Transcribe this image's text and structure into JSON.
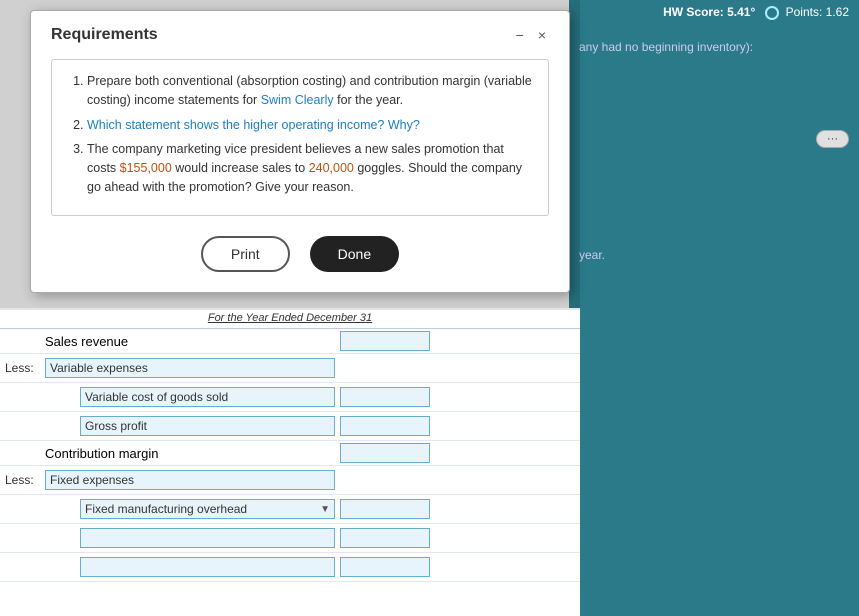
{
  "header": {
    "hw_score_label": "HW Score:",
    "hw_score_value": "5.41°",
    "points_label": "Points:",
    "points_value": "1.62"
  },
  "right_panel": {
    "intro_text": "any had no beginning inventory):",
    "year_text": "year.",
    "expand_btn": "›"
  },
  "modal": {
    "title": "Requirements",
    "minimize": "−",
    "close": "×",
    "requirements": [
      {
        "number": 1,
        "text_parts": [
          {
            "text": "Prepare both conventional (absorption costing) and contribution margin (variable costing) income statements for ",
            "style": "normal"
          },
          {
            "text": "Swim Clearly",
            "style": "highlight"
          },
          {
            "text": " for the year.",
            "style": "normal"
          }
        ]
      },
      {
        "number": 2,
        "text_parts": [
          {
            "text": "Which statement shows the higher operating income? ",
            "style": "highlight"
          },
          {
            "text": "Why?",
            "style": "highlight"
          }
        ]
      },
      {
        "number": 3,
        "text_parts": [
          {
            "text": "The company marketing vice president believes a new sales promotion that costs ",
            "style": "normal"
          },
          {
            "text": "$155,000",
            "style": "orange"
          },
          {
            "text": " would increase sales to ",
            "style": "normal"
          },
          {
            "text": "240,000",
            "style": "orange"
          },
          {
            "text": " goggles. Should the company go ahead with the promotion? Give your reason.",
            "style": "normal"
          }
        ]
      }
    ],
    "print_btn": "Print",
    "done_btn": "Done"
  },
  "table": {
    "header_text": "For the Year Ended December 31",
    "rows": [
      {
        "type": "main",
        "label": "Sales revenue",
        "has_input": true
      },
      {
        "type": "less_header",
        "less": "Less:",
        "sublabel": "Variable expenses",
        "has_input": false
      },
      {
        "type": "sub",
        "label": "Variable cost of goods sold",
        "has_input": true
      },
      {
        "type": "sub",
        "label": "Gross profit",
        "has_input": true
      },
      {
        "type": "main",
        "label": "Contribution margin",
        "has_input": true
      },
      {
        "type": "less_header",
        "less": "Less:",
        "sublabel": "Fixed expenses",
        "has_input": false
      },
      {
        "type": "dropdown",
        "label": "Fixed manufacturing overhead",
        "has_input": true
      },
      {
        "type": "empty",
        "label": "",
        "has_input": true
      },
      {
        "type": "empty2",
        "label": "",
        "has_input": true
      }
    ]
  }
}
